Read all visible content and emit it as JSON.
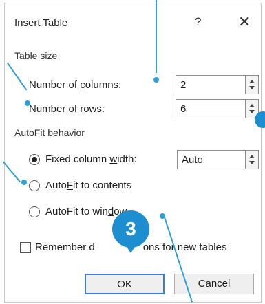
{
  "dialog": {
    "title": "Insert Table",
    "help": "?",
    "close": "✕"
  },
  "table_size": {
    "section_label": "Table size",
    "columns_label_before": "Number of ",
    "columns_label_underlined": "c",
    "columns_label_after": "olumns:",
    "columns_value": "2",
    "rows_label_before": "Number of ",
    "rows_label_underlined": "r",
    "rows_label_after": "ows:",
    "rows_value": "6"
  },
  "autofit": {
    "section_label": "AutoFit behavior",
    "fixed_before": "Fixed column ",
    "fixed_underlined": "w",
    "fixed_after": "idth:",
    "fixed_value": "Auto",
    "contents_before": "Auto",
    "contents_underlined": "F",
    "contents_after": "it to contents",
    "window_before": "AutoFit to win",
    "window_underlined": "d",
    "window_after": "ow",
    "selected": "fixed"
  },
  "remember": {
    "label_before": "Remember d",
    "label_after": "ons for new tables"
  },
  "buttons": {
    "ok": "OK",
    "cancel": "Cancel"
  },
  "annotation": {
    "step_number": "3",
    "accent_color": "#2da0d8",
    "badge_color": "#1d8fd0"
  }
}
